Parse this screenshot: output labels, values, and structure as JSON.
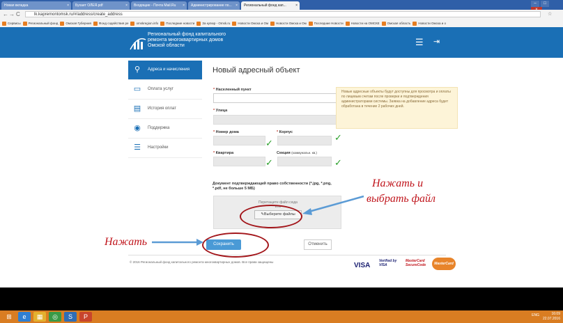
{
  "browser": {
    "tabs": [
      {
        "label": "Новая вкладка",
        "active": false
      },
      {
        "label": "Бухает ОЛЕЯ.pdf",
        "active": false
      },
      {
        "label": "Входящие - Почта Mail.Ru",
        "active": false
      },
      {
        "label": "Администрирование по...",
        "active": false
      },
      {
        "label": "Региональный фонд кап...",
        "active": true
      }
    ],
    "url": "lk.kapremontomsk.ru/#/address/create_address",
    "bookmarks": [
      "Сервисы",
      "Региональный фонд",
      "Омская Губерния",
      "Фонд содействия ре",
      "omskregion.info",
      "Последние новости",
      "За купюр - Omsk.ru",
      "Новости Омска и Ом",
      "Новости Омска и Ом",
      "Последние Новости",
      "Новости на ОМСКЕ",
      "Омская область",
      "Новости Омска и о"
    ]
  },
  "site": {
    "name_lines": [
      "Региональный фонд капитального",
      "ремонта многоквартирных домов",
      "Омской области"
    ],
    "menu_icon": "hamburger-icon",
    "exit_icon": "logout-icon"
  },
  "sidebar": {
    "items": [
      {
        "label": "Адреса и начисления",
        "icon": "map-pin-icon",
        "active": true
      },
      {
        "label": "Оплата услуг",
        "icon": "card-icon",
        "active": false
      },
      {
        "label": "История оплат",
        "icon": "history-icon",
        "active": false
      },
      {
        "label": "Поддержка",
        "icon": "support-icon",
        "active": false
      },
      {
        "label": "Настройки",
        "icon": "settings-icon",
        "active": false
      }
    ]
  },
  "form": {
    "title": "Новый адресный объект",
    "fields": {
      "locality": "Населенный пункт",
      "street": "Улица",
      "house": "Номер дома",
      "building": "Корпус",
      "apartment": "Квартира",
      "section": "Секция",
      "section_note": "(коммунальн. кв.)"
    },
    "hint": "Новые адресные объекты будут доступны для просмотра и оплаты по лицевым счетам после проверки и подтверждения администраторами системы. Заявка на добавление адреса будет обработана в течение 2 рабочих дней.",
    "document_label": "Документ подтверждающий право собственности (*.jpg, *.png, *.pdf, не больше 5 МБ)",
    "drop_text": "Перетащите файл сюда",
    "drop_or": "или",
    "choose_button": "Выберите файлы",
    "save_button": "Сохранить",
    "cancel_button": "Отменить"
  },
  "footer": {
    "copyright": "© 2016 Региональный фонд капитального ремонта многоквартирных домов. Все права защищены",
    "payment_logos": [
      "VISA",
      "Verified by VISA",
      "MasterCard SecureCode",
      "MasterCard"
    ]
  },
  "annotations": {
    "choose_file": [
      "Нажать и",
      "выбрать файл"
    ],
    "press": "Нажать"
  },
  "taskbar": {
    "time": "16:09",
    "date": "22.07.2016",
    "lang": "ENG"
  }
}
